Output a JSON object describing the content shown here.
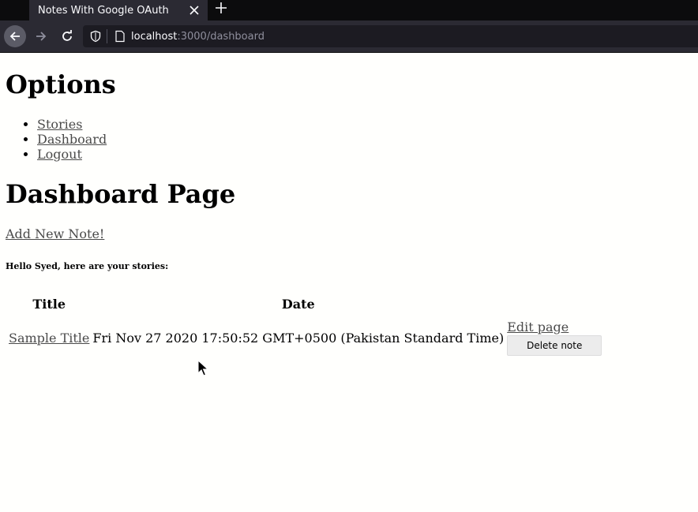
{
  "browser": {
    "tab_title": "Notes With Google OAuth",
    "url_host": "localhost",
    "url_rest": ":3000/dashboard"
  },
  "page": {
    "options_heading": "Options",
    "menu": [
      {
        "label": "Stories"
      },
      {
        "label": "Dashboard"
      },
      {
        "label": "Logout"
      }
    ],
    "dashboard_heading": "Dashboard Page",
    "add_note_link": "Add New Note!",
    "greeting": "Hello Syed, here are your stories:",
    "table": {
      "headers": [
        "Title",
        "Date"
      ],
      "rows": [
        {
          "title": "Sample Title",
          "date": "Fri Nov 27 2020 17:50:52 GMT+0500 (Pakistan Standard Time)",
          "edit_label": "Edit page",
          "delete_label": "Delete note"
        }
      ]
    }
  },
  "colors": {
    "chrome_dark": "#0c0c0d",
    "chrome_tab": "#2b2a33",
    "urlbar": "#1c1b22",
    "link": "#4a4a4a"
  }
}
